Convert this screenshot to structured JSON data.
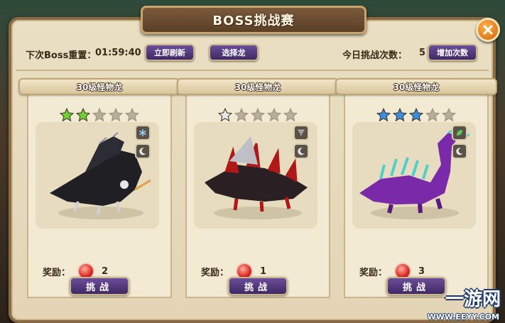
{
  "window": {
    "title": "BOSS挑战赛"
  },
  "header": {
    "reset_label": "下次Boss重置：",
    "reset_time": "01:59:40",
    "refresh_button": "立即刷新",
    "select_dragon_button": "选择龙",
    "attempts_label": "今日挑战次数：",
    "attempts_count": "5",
    "add_attempts_button": "增加次数"
  },
  "cards": [
    {
      "name": "30级怪物龙",
      "stars_filled": 2,
      "stars_total": 5,
      "star_color": "#6fd13a",
      "element_icon": "snowflake-icon",
      "element_color": "#8ec9ff",
      "moon_icon": "moon-icon",
      "reward_label": "奖励：",
      "reward_count": "2",
      "challenge_label": "挑战",
      "dragon": "black-bone-dragon"
    },
    {
      "name": "30级怪物龙",
      "stars_filled": 1,
      "stars_total": 5,
      "star_color": "#e8e8ea",
      "element_icon": "tornado-icon",
      "element_color": "#d0d0d0",
      "moon_icon": "moon-icon",
      "reward_label": "奖励：",
      "reward_count": "1",
      "challenge_label": "挑战",
      "dragon": "spiked-red-black-dragon"
    },
    {
      "name": "30级怪物龙",
      "stars_filled": 3,
      "stars_total": 5,
      "star_color": "#3a8de0",
      "element_icon": "leaf-icon",
      "element_color": "#5cc85c",
      "moon_icon": "moon-icon",
      "reward_label": "奖励：",
      "reward_count": "3",
      "challenge_label": "挑战",
      "dragon": "purple-teal-dragon"
    }
  ],
  "watermark": {
    "cn": "一游网",
    "en": "WWW.EEYY.COM"
  }
}
